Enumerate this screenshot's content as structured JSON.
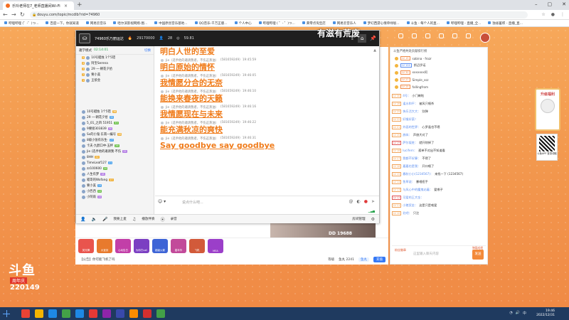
{
  "browser": {
    "tab_title": "乐玲老师在7_老师直播间Wi-Fi",
    "url": "douyu.com/topic/mcdlb?rid=74960",
    "bookmarks": [
      "哔哩哔哩 (゜-゜)つ...",
      "百度一下，你就知道",
      "网易云音乐",
      "哈尔滨影视网络-图...",
      "中国原创音乐基地...",
      "QQ音乐-千万正版...",
      "个人中心",
      "哔哩哔哩 ( ゜- ゜)つ...",
      "黄零点淘宝店",
      "网易云音乐人",
      "梦幻西游心情单绿坂...",
      "斗鱼 - 每个人的直...",
      "哔哩哔哩 - 直播_全...",
      "独省蓄积 - 直播_直..."
    ]
  },
  "room": {
    "stream_title": "74960乐乃丽运达",
    "hot_count": "29170000",
    "followers": "28",
    "score": "59.81",
    "banner": "有滋有荒废",
    "thumb_text": "DD 19688"
  },
  "left_panel": {
    "mode_label": "趣学模式",
    "timer": "02:14:01",
    "switch_label": "切换",
    "top_users": [
      {
        "name": "10号蜡烛 1个5错",
        "lv": "5"
      },
      {
        "name": "阿宝Serena",
        "lv": "4"
      },
      {
        "name": "29 一·朝花夕拾",
        "lv": "3"
      },
      {
        "name": "要小美",
        "lv": "2"
      },
      {
        "name": "王侬金",
        "lv": "1"
      }
    ],
    "users": [
      {
        "name": "10号蜡烛 1个5错",
        "lv": "38"
      },
      {
        "name": "29 一·朝花夕拾",
        "lv": "35"
      },
      {
        "name": "5_01_之四 51951",
        "lv": "33"
      },
      {
        "name": "9要接303839",
        "lv": "30"
      },
      {
        "name": "Sx的小鬼·东南一编号",
        "lv": "28"
      },
      {
        "name": "8级小张有乐生·",
        "lv": "27"
      },
      {
        "name": "卡夫·九醇口中·五杯",
        "lv": "26"
      },
      {
        "name": "Jie (选手他的邀请我·不伤",
        "lv": "25"
      },
      {
        "name": "8HH",
        "lv": "22"
      },
      {
        "name": "TimeLeaf127",
        "lv": "21"
      },
      {
        "name": "zz100600",
        "lv": "20"
      },
      {
        "name": "人生有梦",
        "lv": "18"
      },
      {
        "name": "喵哥的Wofang",
        "lv": "17"
      },
      {
        "name": "要小美",
        "lv": "15"
      },
      {
        "name": "小西西",
        "lv": "12"
      },
      {
        "name": "小阿雨",
        "lv": "10"
      }
    ]
  },
  "chat": {
    "first_line": "明白人世的至爱",
    "messages": [
      {
        "user": "Jie（选手他的邀请我者，不伤这蒸油）",
        "id": "(581659249)",
        "time": "19:45:59",
        "text": "明白原始的情怀"
      },
      {
        "user": "Jie（选手他的邀请我者，不伤这蒸油）",
        "id": "(581659249)",
        "time": "19:46:05",
        "text": "我情愿分合的无奈"
      },
      {
        "user": "Jie（选手他的邀请我者，不伤这蒸油）",
        "id": "(581659249)",
        "time": "19:46:10",
        "text": "能换来春夜的天籁"
      },
      {
        "user": "Jie（选手他的邀请我者，不伤这蒸油）",
        "id": "(581659249)",
        "time": "19:46:16",
        "text": "我情愿现在与未来"
      },
      {
        "user": "Jie（选手他的邀请我者，不伤这蒸油）",
        "id": "(581659249)",
        "time": "19:46:22",
        "text": "能充满秋凉的爽快"
      },
      {
        "user": "Jie（选手他的邀请我者，不伤这蒸油）",
        "id": "(581659249)",
        "time": "19:46:31",
        "text": "Say goodbye say goodbye"
      }
    ],
    "input_placeholder": "说点什么吧...",
    "emoji_label": "表情",
    "bars_label": "信号"
  },
  "vbar": {
    "item1": "我要上麦",
    "item2": "播放伴奏",
    "item3": "录音",
    "right": "房间管理"
  },
  "gifts": [
    {
      "label": "荧光棒",
      "color": "#e9544d"
    },
    {
      "label": "大宝剑",
      "color": "#e87a2d"
    },
    {
      "label": "心动告白",
      "color": "#c23fa8"
    },
    {
      "label": "为你打call",
      "color": "#7b3fc2"
    },
    {
      "label": "超级火箭",
      "color": "#3d64d6"
    },
    {
      "label": "嘉年华",
      "color": "#c24a9a"
    },
    {
      "label": "飞机",
      "color": "#d25a3a"
    },
    {
      "label": "MEA",
      "color": "#9b3fc9"
    }
  ],
  "room_foot": {
    "report": "【公告】你可能飞机了吗",
    "level": "等级",
    "fish_label": "鱼丸 2241",
    "fish_bar": "鱼丸",
    "recharge": "充值",
    "chat_tag": "弹幕"
  },
  "rpanel": {
    "head": "斗鱼严格共处贡献排行榜",
    "ranks": [
      {
        "lv": "LV 19",
        "name": "sabina · frozr",
        "blue": false
      },
      {
        "lv": "LV 104",
        "name": "斯迈伊诺",
        "blue": true
      },
      {
        "lv": "LV 30",
        "name": "xxxxxxx阿",
        "blue": false
      },
      {
        "lv": "LV 27",
        "name": "Simple_ssz",
        "blue": false
      },
      {
        "lv": "LV 25",
        "name": "fallingfrom",
        "blue": false
      }
    ],
    "chat": [
      {
        "bd": "LV 30",
        "nm": "4号：",
        "tx": "小门喇啦",
        "red": false
      },
      {
        "bd": "LV 28",
        "nm": "逢水和平：",
        "tx": "被风只唱杀",
        "red": false
      },
      {
        "bd": "LV 25",
        "nm": "快乐活大大：",
        "tx": "别弹",
        "red": false
      },
      {
        "bd": "LV 22",
        "nm": "好猴好菜！",
        "tx": "",
        "red": false
      },
      {
        "bd": "LV 21",
        "nm": "外面的世界：",
        "tx": "心罗逢也不嗯",
        "red": false
      },
      {
        "bd": "LV 20",
        "nm": "放纵：",
        "tx": "声旅大对了",
        "red": false
      },
      {
        "bd": "LV 19",
        "nm": "萨尔坂姓：",
        "tx": "就开除掉了",
        "red": true
      },
      {
        "bd": "LV 18",
        "nm": "lucifern：",
        "tx": "孤单不对出不知道看",
        "red": false
      },
      {
        "bd": "LV 17",
        "nm": "我都不好算：",
        "tx": "不得了",
        "red": false
      },
      {
        "bd": "LV 16",
        "nm": "嘉嘉也是我：",
        "tx": "开口唱了",
        "red": false
      },
      {
        "bd": "LV 15",
        "nm": "春秋小小(1234567)：",
        "tx": "来找一下 (1234567)",
        "red": false
      },
      {
        "bd": "LV 14",
        "nm": "鱼草说：",
        "tx": "暴唱招手",
        "red": false
      },
      {
        "bd": "LV 13",
        "nm": "与风心中的魔鬼站着：",
        "tx": "爱哪子",
        "red": false
      },
      {
        "bd": "LV 12",
        "nm": "可爱的王大金：",
        "tx": "",
        "red": true
      },
      {
        "bd": "LV 11",
        "nm": "小猪奖金：",
        "tx": "这是只是唯爱",
        "red": false
      },
      {
        "bd": "LV 10",
        "nm": "北吧：",
        "tx": "只注",
        "red": false
      }
    ],
    "fans_label": "粉丝徽章",
    "hint": "弹幕成就",
    "input_placeholder": "这里输入聊天内容",
    "send": "发送"
  },
  "float": {
    "card_title": "升级福利",
    "qr_label": "斗鱼APP 登录领取"
  },
  "page": {
    "logo": "斗鱼",
    "logo_sub": "周年庆",
    "logo_num": "220149"
  },
  "taskbar": {
    "time": "19:46",
    "date": "2022/12/31"
  }
}
